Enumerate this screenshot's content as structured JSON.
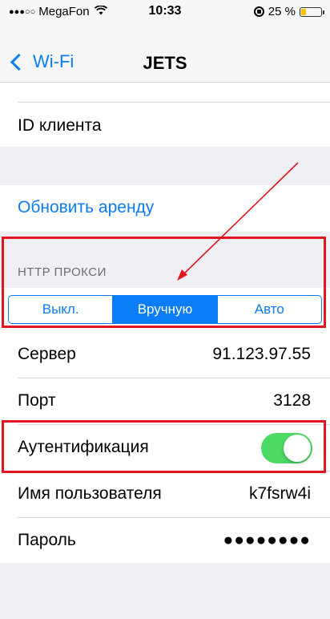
{
  "status_bar": {
    "signal": "●●●○○",
    "carrier": "MegaFon",
    "wifi_icon": "wifi-icon",
    "time": "10:33",
    "battery_percent": "25 %",
    "battery_level": 0.25,
    "battery_color": "#f5c400"
  },
  "nav": {
    "back_label": "Wi-Fi",
    "title": "JETS"
  },
  "rows": {
    "client_id_label": "ID клиента",
    "renew_label": "Обновить аренду"
  },
  "proxy": {
    "section_title": "HTTP ПРОКСИ",
    "segments": [
      "Выкл.",
      "Вручную",
      "Авто"
    ],
    "selected": "Вручную",
    "accent": "#0a7cf5"
  },
  "fields": {
    "server_label": "Сервер",
    "server_value": "91.123.97.55",
    "port_label": "Порт",
    "port_value": "3128",
    "auth_label": "Аутентификация",
    "auth_enabled": true,
    "auth_toggle_color": "#4cd964",
    "username_label": "Имя пользователя",
    "username_value": "k7fsrw4i",
    "password_label": "Пароль",
    "password_value": "●●●●●●●●"
  },
  "annotations": {
    "highlight_color": "#e3161f"
  }
}
